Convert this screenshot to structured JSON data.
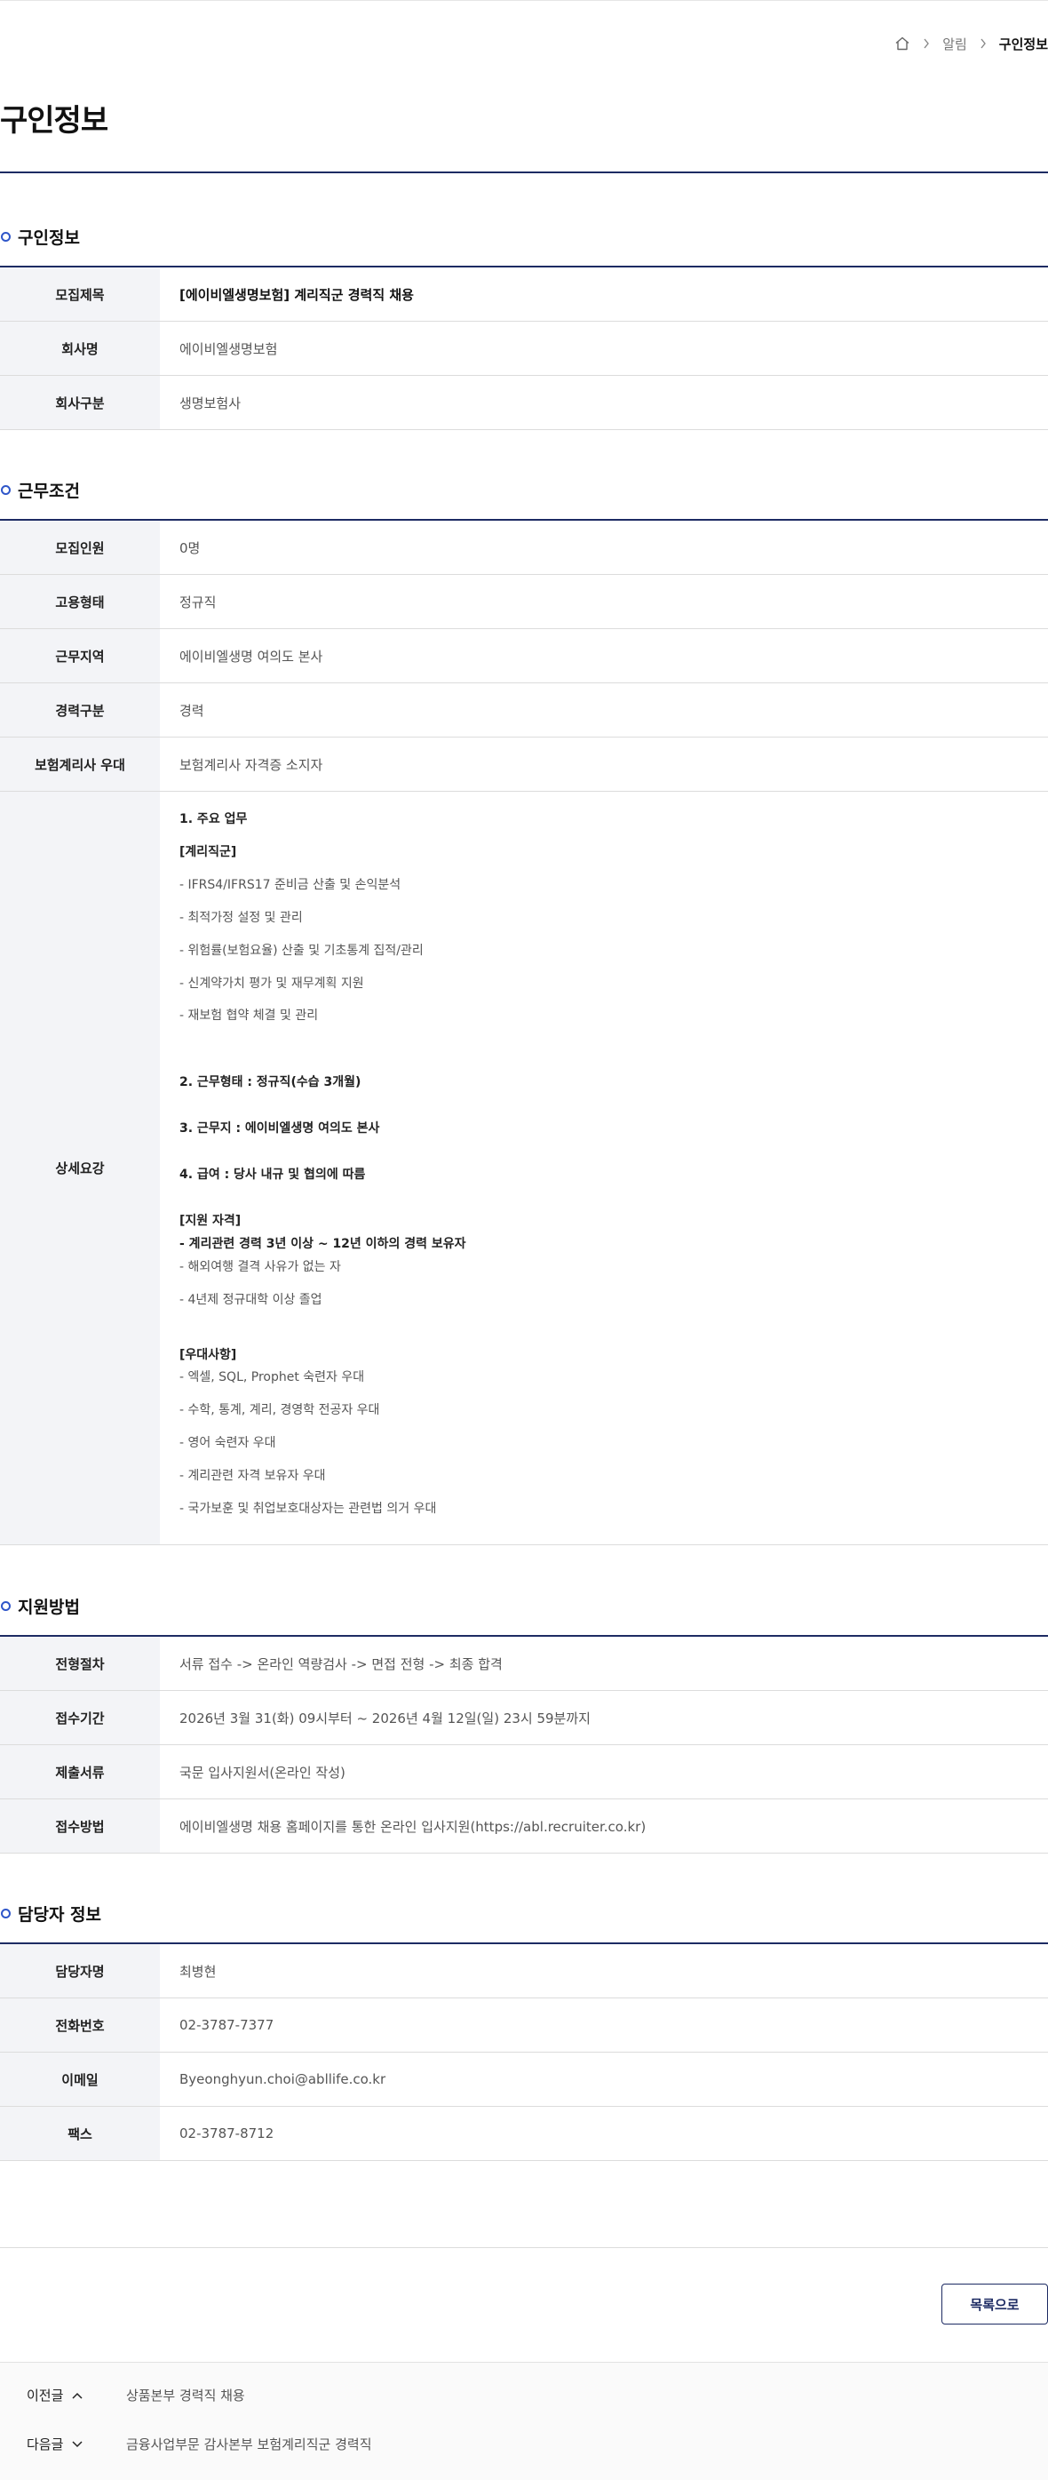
{
  "breadcrumb": {
    "items": [
      "알림",
      "구인정보"
    ]
  },
  "page_title": "구인정보",
  "sections": {
    "job_info": {
      "title": "구인정보",
      "rows": [
        {
          "label": "모집제목",
          "value": "[에이비엘생명보험] 계리직군 경력직 채용"
        },
        {
          "label": "회사명",
          "value": "에이비엘생명보험"
        },
        {
          "label": "회사구분",
          "value": "생명보험사"
        }
      ]
    },
    "conditions": {
      "title": "근무조건",
      "rows": [
        {
          "label": "모집인원",
          "value": "0명"
        },
        {
          "label": "고용형태",
          "value": "정규직"
        },
        {
          "label": "근무지역",
          "value": "에이비엘생명 여의도 본사"
        },
        {
          "label": "경력구분",
          "value": "경력"
        },
        {
          "label": "보험계리사 우대",
          "value": "보험계리사 자격증 소지자"
        }
      ],
      "detail_label": "상세요강",
      "detail_lines": [
        "1. 주요 업무",
        "[계리직군]",
        "- IFRS4/IFRS17 준비금 산출 및 손익분석",
        "- 최적가정 설정 및 관리",
        "- 위험률(보험요율) 산출 및 기초통계 집적/관리",
        "- 신계약가치 평가 및 재무계획 지원",
        "- 재보험 협약 체결 및 관리",
        "2. 근무형태 : 정규직(수습 3개월)",
        "3. 근무지 : 에이비엘생명 여의도 본사",
        "4. 급여 : 당사 내규 및 협의에 따름",
        "[지원 자격]",
        "- 계리관련 경력 3년 이상 ~ 12년 이하의 경력 보유자",
        "- 해외여행 결격 사유가 없는 자",
        "- 4년제 정규대학 이상 졸업",
        "[우대사항]",
        "- 엑셀, SQL, Prophet 숙련자 우대",
        "- 수학, 통계, 계리, 경영학 전공자 우대",
        "- 영어 숙련자 우대",
        "- 계리관련 자격 보유자 우대",
        "- 국가보훈 및 취업보호대상자는 관련법 의거 우대"
      ]
    },
    "apply": {
      "title": "지원방법",
      "rows": [
        {
          "label": "전형절차",
          "value": "서류 접수 -> 온라인 역량검사 -> 면접 전형 -> 최종 합격"
        },
        {
          "label": "접수기간",
          "value": "2026년 3월 31(화) 09시부터 ~ 2026년 4월 12일(일) 23시 59분까지"
        },
        {
          "label": "제출서류",
          "value": "국문 입사지원서(온라인 작성)"
        },
        {
          "label": "접수방법",
          "value": "에이비엘생명 채용 홈페이지를 통한 온라인 입사지원(https://abl.recruiter.co.kr)"
        }
      ]
    },
    "contact": {
      "title": "담당자 정보",
      "rows": [
        {
          "label": "담당자명",
          "value": "최병현"
        },
        {
          "label": "전화번호",
          "value": "02-3787-7377"
        },
        {
          "label": "이메일",
          "value": "Byeonghyun.choi@abllife.co.kr"
        },
        {
          "label": "팩스",
          "value": "02-3787-8712"
        }
      ]
    }
  },
  "list_button": "목록으로",
  "nav": {
    "prev_label": "이전글",
    "prev_title": "상품본부 경력직 채용",
    "next_label": "다음글",
    "next_title": "금융사업부문 감사본부 보험계리직군 경력직"
  },
  "colors": {
    "accent": "#1d2b63",
    "dot": "#2f56c9",
    "header_bg": "#f3f4f7"
  },
  "icons": {
    "home": "home-icon",
    "separator": "chevron-right-icon",
    "prev": "chevron-up-icon",
    "next": "chevron-down-icon"
  }
}
